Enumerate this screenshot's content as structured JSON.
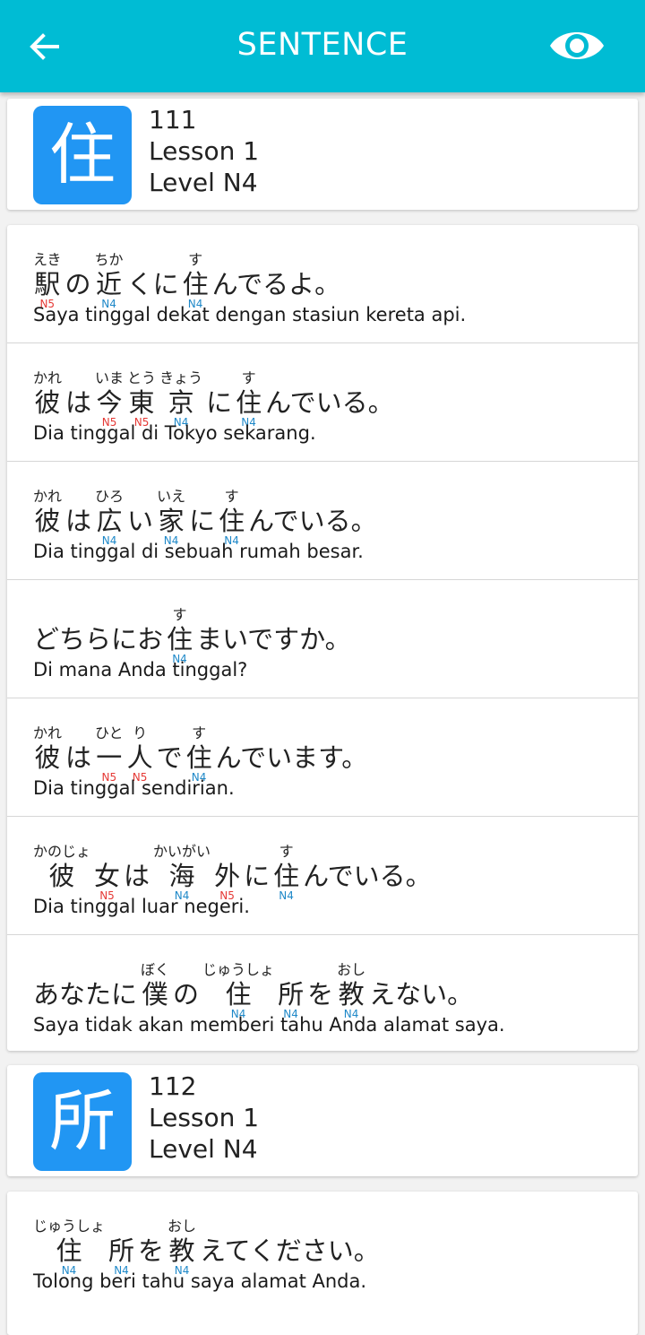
{
  "header": {
    "title": "SENTENCE",
    "back_icon": "arrow-left-icon",
    "view_icon": "eye-icon",
    "color": "#00bcd4"
  },
  "kanji_cards": [
    {
      "kanji": "住",
      "number": "111",
      "lesson": "Lesson 1",
      "level": "Level N4",
      "sentences": [
        {
          "jp": [
            {
              "b": "駅",
              "r": "えき",
              "l": "N5"
            },
            {
              "b": "の"
            },
            {
              "b": "近",
              "r": "ちか",
              "l": "N4"
            },
            {
              "b": "くに"
            },
            {
              "b": "住",
              "r": "す",
              "l": "N4"
            },
            {
              "b": "んでるよ。"
            }
          ],
          "tr": "Saya tinggal dekat dengan stasiun kereta api."
        },
        {
          "jp": [
            {
              "b": "彼",
              "r": "かれ"
            },
            {
              "b": "は"
            },
            {
              "b": "今",
              "r": "いま",
              "l": "N5"
            },
            {
              "b": "東",
              "r": "とう",
              "l": "N5"
            },
            {
              "b": "京",
              "r": "きょう",
              "l": "N4"
            },
            {
              "b": "に"
            },
            {
              "b": "住",
              "r": "す",
              "l": "N4"
            },
            {
              "b": "んでいる。"
            }
          ],
          "tr": "Dia tinggal di Tokyo sekarang."
        },
        {
          "jp": [
            {
              "b": "彼",
              "r": "かれ"
            },
            {
              "b": "は"
            },
            {
              "b": "広",
              "r": "ひろ",
              "l": "N4"
            },
            {
              "b": "い"
            },
            {
              "b": "家",
              "r": "いえ",
              "l": "N4"
            },
            {
              "b": "に"
            },
            {
              "b": "住",
              "r": "す",
              "l": "N4"
            },
            {
              "b": "んでいる。"
            }
          ],
          "tr": "Dia tinggal di sebuah rumah besar."
        },
        {
          "jp": [
            {
              "b": "どちらにお"
            },
            {
              "b": "住",
              "r": "す",
              "l": "N4"
            },
            {
              "b": "まいですか。"
            }
          ],
          "tr": "Di mana Anda tinggal?"
        },
        {
          "jp": [
            {
              "b": "彼",
              "r": "かれ"
            },
            {
              "b": "は"
            },
            {
              "b": "一",
              "r": "ひと",
              "l": "N5"
            },
            {
              "b": "人",
              "r": "り",
              "l": "N5"
            },
            {
              "b": "で"
            },
            {
              "b": "住",
              "r": "す",
              "l": "N4"
            },
            {
              "b": "んでいます。"
            }
          ],
          "tr": "Dia tinggal sendirian."
        },
        {
          "jp": [
            {
              "b": "彼",
              "r": "かのじょ"
            },
            {
              "b": "女",
              "l": "N5"
            },
            {
              "b": "は"
            },
            {
              "b": "海",
              "r": "かいがい",
              "l": "N4"
            },
            {
              "b": "外",
              "l": "N5"
            },
            {
              "b": "に"
            },
            {
              "b": "住",
              "r": "す",
              "l": "N4"
            },
            {
              "b": "んでいる。"
            }
          ],
          "tr": "Dia tinggal luar negeri."
        },
        {
          "jp": [
            {
              "b": "あなたに"
            },
            {
              "b": "僕",
              "r": "ぼく"
            },
            {
              "b": "の"
            },
            {
              "b": "住",
              "r": "じゅうしょ",
              "l": "N4"
            },
            {
              "b": "所",
              "l": "N4"
            },
            {
              "b": "を"
            },
            {
              "b": "教",
              "r": "おし",
              "l": "N4"
            },
            {
              "b": "えない。"
            }
          ],
          "tr": "Saya tidak akan memberi tahu Anda alamat saya."
        }
      ]
    },
    {
      "kanji": "所",
      "number": "112",
      "lesson": "Lesson 1",
      "level": "Level N4",
      "sentences": [
        {
          "jp": [
            {
              "b": "住",
              "r": "じゅうしょ",
              "l": "N4"
            },
            {
              "b": "所",
              "l": "N4"
            },
            {
              "b": "を"
            },
            {
              "b": "教",
              "r": "おし",
              "l": "N4"
            },
            {
              "b": "えてください。"
            }
          ],
          "tr": "Tolong beri tahu saya alamat Anda."
        }
      ]
    }
  ],
  "colors": {
    "kanji_box": "#2196f3",
    "level_N5": "#e53935",
    "level_N4": "#1e88c8"
  }
}
